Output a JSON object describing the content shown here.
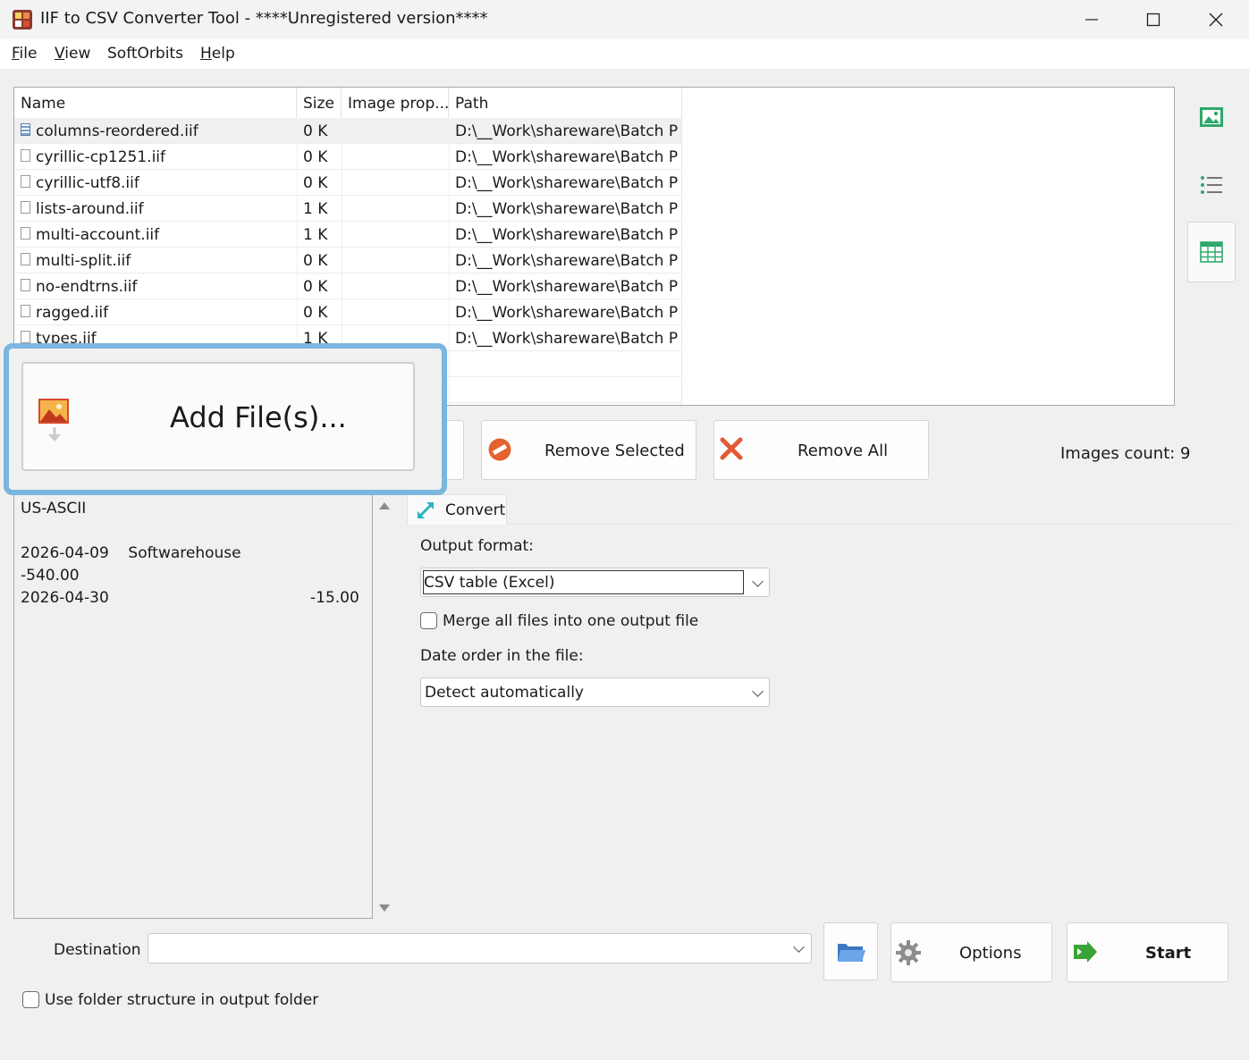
{
  "window": {
    "title": "IIF to CSV Converter Tool - ****Unregistered version****"
  },
  "menu": {
    "items": [
      {
        "label": "File",
        "accel": "F",
        "rest": "ile"
      },
      {
        "label": "View",
        "accel": "V",
        "rest": "iew"
      },
      {
        "label": "SoftOrbits",
        "accel": "",
        "rest": "SoftOrbits"
      },
      {
        "label": "Help",
        "accel": "H",
        "rest": "elp"
      }
    ]
  },
  "file_list": {
    "columns": [
      "Name",
      "Size",
      "Image prop...",
      "Path"
    ],
    "rows": [
      {
        "name": "columns-reordered.iif",
        "size": "0 K",
        "prop": "",
        "path": "D:\\__Work\\shareware\\Batch Pi...",
        "selected": true
      },
      {
        "name": "cyrillic-cp1251.iif",
        "size": "0 K",
        "prop": "",
        "path": "D:\\__Work\\shareware\\Batch Pi..."
      },
      {
        "name": "cyrillic-utf8.iif",
        "size": "0 K",
        "prop": "",
        "path": "D:\\__Work\\shareware\\Batch Pi..."
      },
      {
        "name": "lists-around.iif",
        "size": "1 K",
        "prop": "",
        "path": "D:\\__Work\\shareware\\Batch Pi..."
      },
      {
        "name": "multi-account.iif",
        "size": "1 K",
        "prop": "",
        "path": "D:\\__Work\\shareware\\Batch Pi..."
      },
      {
        "name": "multi-split.iif",
        "size": "0 K",
        "prop": "",
        "path": "D:\\__Work\\shareware\\Batch Pi..."
      },
      {
        "name": "no-endtrns.iif",
        "size": "0 K",
        "prop": "",
        "path": "D:\\__Work\\shareware\\Batch Pi..."
      },
      {
        "name": "ragged.iif",
        "size": "0 K",
        "prop": "",
        "path": "D:\\__Work\\shareware\\Batch Pi..."
      },
      {
        "name": "types.iif",
        "size": "1 K",
        "prop": "",
        "path": "D:\\__Work\\shareware\\Batch Pi..."
      }
    ]
  },
  "toolbar": {
    "add_files_label": "Add File(s)...",
    "add_files_accel": "l",
    "remove_selected_label": "Remove Selected",
    "remove_all_label": "Remove All",
    "images_count": "Images count: 9"
  },
  "preview": {
    "lines": [
      {
        "left": "US-ASCII",
        "right": ""
      },
      {
        "left": "",
        "right": ""
      },
      {
        "left": "2026-04-09    Softwarehouse",
        "right": ""
      },
      {
        "left": "-540.00",
        "right": ""
      },
      {
        "left": "2026-04-30",
        "right": "-15.00"
      }
    ]
  },
  "convert": {
    "tab_label": "Convert",
    "output_format_label": "Output format:",
    "output_format_value": "CSV table (Excel)",
    "merge_label": "Merge all files into one output file",
    "merge_checked": false,
    "date_order_label": "Date order in the file:",
    "date_order_value": "Detect automatically"
  },
  "bottom": {
    "destination_label": "Destination",
    "destination_value": "",
    "options_label": "Options",
    "start_label": "Start",
    "folder_structure_label": "Use folder structure in output folder",
    "folder_structure_checked": false
  },
  "colors": {
    "accent_highlight": "#7ab6e0",
    "start_arrow": "#3aa335",
    "remove_all_x": "#e25a35"
  }
}
